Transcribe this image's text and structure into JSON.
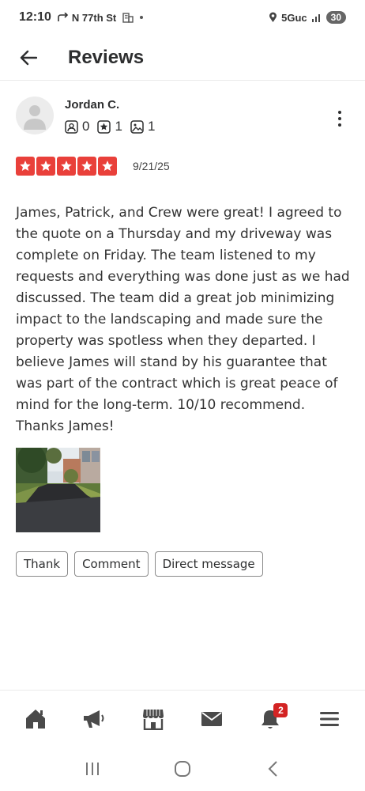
{
  "status_bar": {
    "time": "12:10",
    "location": "N 77th St",
    "network": "5Guc",
    "battery": "30"
  },
  "header": {
    "title": "Reviews",
    "back_icon": "arrow-left-icon"
  },
  "review": {
    "reviewer_name": "Jordan C.",
    "stats": {
      "friends": "0",
      "reviews": "1",
      "photos": "1"
    },
    "rating": 5,
    "star_color": "#e9403a",
    "date": "9/21/25",
    "text": "James, Patrick, and Crew were great! I agreed to the quote on a Thursday and my driveway was complete on Friday. The team listened to my requests and everything was done just as we had discussed. The team did a great job minimizing impact to the landscaping and made sure the property was spotless when they departed. I believe James will stand by his guarantee that was part of the contract which is great peace of mind for the long-term. 10/10 recommend. Thanks James!"
  },
  "actions": {
    "thank": "Thank",
    "comment": "Comment",
    "direct_message": "Direct message"
  },
  "bottom_nav": {
    "notifications_badge": "2",
    "items": [
      "home-icon",
      "megaphone-icon",
      "storefront-icon",
      "mail-icon",
      "bell-icon",
      "menu-icon"
    ]
  },
  "colors": {
    "accent": "#d32323",
    "text": "#2d2e2f"
  }
}
